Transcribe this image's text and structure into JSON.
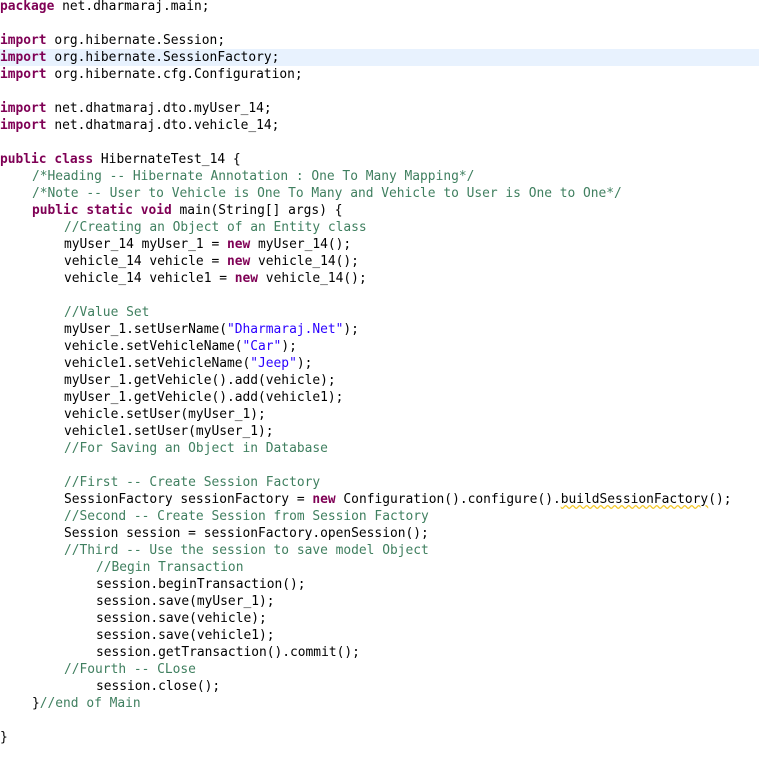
{
  "editor": {
    "current_line": 3,
    "lines": [
      {
        "indent": 0,
        "tokens": [
          {
            "t": "kw",
            "v": "package"
          },
          {
            "t": "pl",
            "v": " net.dharmaraj.main;"
          }
        ]
      },
      {
        "indent": 0,
        "tokens": []
      },
      {
        "indent": 0,
        "tokens": [
          {
            "t": "kw",
            "v": "import"
          },
          {
            "t": "pl",
            "v": " org.hibernate.Session;"
          }
        ]
      },
      {
        "indent": 0,
        "tokens": [
          {
            "t": "kw",
            "v": "import"
          },
          {
            "t": "pl",
            "v": " org.hibernate.SessionFactory;"
          }
        ]
      },
      {
        "indent": 0,
        "tokens": [
          {
            "t": "kw",
            "v": "import"
          },
          {
            "t": "pl",
            "v": " org.hibernate.cfg.Configuration;"
          }
        ]
      },
      {
        "indent": 0,
        "tokens": []
      },
      {
        "indent": 0,
        "tokens": [
          {
            "t": "kw",
            "v": "import"
          },
          {
            "t": "pl",
            "v": " net.dhatmaraj.dto.myUser_14;"
          }
        ]
      },
      {
        "indent": 0,
        "tokens": [
          {
            "t": "kw",
            "v": "import"
          },
          {
            "t": "pl",
            "v": " net.dhatmaraj.dto.vehicle_14;"
          }
        ]
      },
      {
        "indent": 0,
        "tokens": []
      },
      {
        "indent": 0,
        "tokens": [
          {
            "t": "kw",
            "v": "public"
          },
          {
            "t": "pl",
            "v": " "
          },
          {
            "t": "kw",
            "v": "class"
          },
          {
            "t": "pl",
            "v": " HibernateTest_14 {"
          }
        ]
      },
      {
        "indent": 1,
        "tokens": [
          {
            "t": "cm",
            "v": "/*Heading -- Hibernate Annotation : One To Many Mapping*/"
          }
        ]
      },
      {
        "indent": 1,
        "tokens": [
          {
            "t": "cm",
            "v": "/*Note -- User to Vehicle is One To Many and Vehicle to User is One to One*/"
          }
        ]
      },
      {
        "indent": 1,
        "tokens": [
          {
            "t": "kw",
            "v": "public"
          },
          {
            "t": "pl",
            "v": " "
          },
          {
            "t": "kw",
            "v": "static"
          },
          {
            "t": "pl",
            "v": " "
          },
          {
            "t": "kw",
            "v": "void"
          },
          {
            "t": "pl",
            "v": " main(String[] args) {"
          }
        ]
      },
      {
        "indent": 2,
        "tokens": [
          {
            "t": "cm",
            "v": "//Creating an Object of an Entity class"
          }
        ]
      },
      {
        "indent": 2,
        "tokens": [
          {
            "t": "pl",
            "v": "myUser_14 myUser_1 = "
          },
          {
            "t": "kw",
            "v": "new"
          },
          {
            "t": "pl",
            "v": " myUser_14();"
          }
        ]
      },
      {
        "indent": 2,
        "tokens": [
          {
            "t": "pl",
            "v": "vehicle_14 vehicle = "
          },
          {
            "t": "kw",
            "v": "new"
          },
          {
            "t": "pl",
            "v": " vehicle_14();"
          }
        ]
      },
      {
        "indent": 2,
        "tokens": [
          {
            "t": "pl",
            "v": "vehicle_14 vehicle1 = "
          },
          {
            "t": "kw",
            "v": "new"
          },
          {
            "t": "pl",
            "v": " vehicle_14();"
          }
        ]
      },
      {
        "indent": 0,
        "tokens": []
      },
      {
        "indent": 2,
        "tokens": [
          {
            "t": "cm",
            "v": "//Value Set"
          }
        ]
      },
      {
        "indent": 2,
        "tokens": [
          {
            "t": "pl",
            "v": "myUser_1.setUserName("
          },
          {
            "t": "str",
            "v": "\"Dharmaraj.Net\""
          },
          {
            "t": "pl",
            "v": ");"
          }
        ]
      },
      {
        "indent": 2,
        "tokens": [
          {
            "t": "pl",
            "v": "vehicle.setVehicleName("
          },
          {
            "t": "str",
            "v": "\"Car\""
          },
          {
            "t": "pl",
            "v": ");"
          }
        ]
      },
      {
        "indent": 2,
        "tokens": [
          {
            "t": "pl",
            "v": "vehicle1.setVehicleName("
          },
          {
            "t": "str",
            "v": "\"Jeep\""
          },
          {
            "t": "pl",
            "v": ");"
          }
        ]
      },
      {
        "indent": 2,
        "tokens": [
          {
            "t": "pl",
            "v": "myUser_1.getVehicle().add(vehicle);"
          }
        ]
      },
      {
        "indent": 2,
        "tokens": [
          {
            "t": "pl",
            "v": "myUser_1.getVehicle().add(vehicle1);"
          }
        ]
      },
      {
        "indent": 2,
        "tokens": [
          {
            "t": "pl",
            "v": "vehicle.setUser(myUser_1);"
          }
        ]
      },
      {
        "indent": 2,
        "tokens": [
          {
            "t": "pl",
            "v": "vehicle1.setUser(myUser_1);"
          }
        ]
      },
      {
        "indent": 2,
        "tokens": [
          {
            "t": "cm",
            "v": "//For Saving an Object in Database"
          }
        ]
      },
      {
        "indent": 0,
        "tokens": []
      },
      {
        "indent": 2,
        "tokens": [
          {
            "t": "cm",
            "v": "//First -- Create Session Factory"
          }
        ]
      },
      {
        "indent": 2,
        "tokens": [
          {
            "t": "pl",
            "v": "SessionFactory sessionFactory = "
          },
          {
            "t": "kw",
            "v": "new"
          },
          {
            "t": "pl",
            "v": " Configuration().configure()."
          },
          {
            "t": "warn",
            "v": "buildSessionFactory"
          },
          {
            "t": "pl",
            "v": "();"
          }
        ]
      },
      {
        "indent": 2,
        "tokens": [
          {
            "t": "cm",
            "v": "//Second -- Create Session from Session Factory"
          }
        ]
      },
      {
        "indent": 2,
        "tokens": [
          {
            "t": "pl",
            "v": "Session session = sessionFactory.openSession();"
          }
        ]
      },
      {
        "indent": 2,
        "tokens": [
          {
            "t": "cm",
            "v": "//Third -- Use the session to save model Object"
          }
        ]
      },
      {
        "indent": 3,
        "tokens": [
          {
            "t": "cm",
            "v": "//Begin Transaction"
          }
        ]
      },
      {
        "indent": 3,
        "tokens": [
          {
            "t": "pl",
            "v": "session.beginTransaction();"
          }
        ]
      },
      {
        "indent": 3,
        "tokens": [
          {
            "t": "pl",
            "v": "session.save(myUser_1);"
          }
        ]
      },
      {
        "indent": 3,
        "tokens": [
          {
            "t": "pl",
            "v": "session.save(vehicle);"
          }
        ]
      },
      {
        "indent": 3,
        "tokens": [
          {
            "t": "pl",
            "v": "session.save(vehicle1);"
          }
        ]
      },
      {
        "indent": 3,
        "tokens": [
          {
            "t": "pl",
            "v": "session.getTransaction().commit();"
          }
        ]
      },
      {
        "indent": 2,
        "tokens": [
          {
            "t": "cm",
            "v": "//Fourth -- CLose"
          }
        ]
      },
      {
        "indent": 3,
        "tokens": [
          {
            "t": "pl",
            "v": "session.close();"
          }
        ]
      },
      {
        "indent": 1,
        "tokens": [
          {
            "t": "pl",
            "v": "}"
          },
          {
            "t": "cm",
            "v": "//end of Main"
          }
        ]
      },
      {
        "indent": 0,
        "tokens": []
      },
      {
        "indent": 0,
        "tokens": [
          {
            "t": "pl",
            "v": "}"
          }
        ]
      }
    ]
  },
  "colors": {
    "keyword": "#7f0055",
    "comment": "#3f7f5f",
    "string": "#2a00ff",
    "current_line": "#e8f2fe",
    "warning_underline": "#f4c82d"
  }
}
